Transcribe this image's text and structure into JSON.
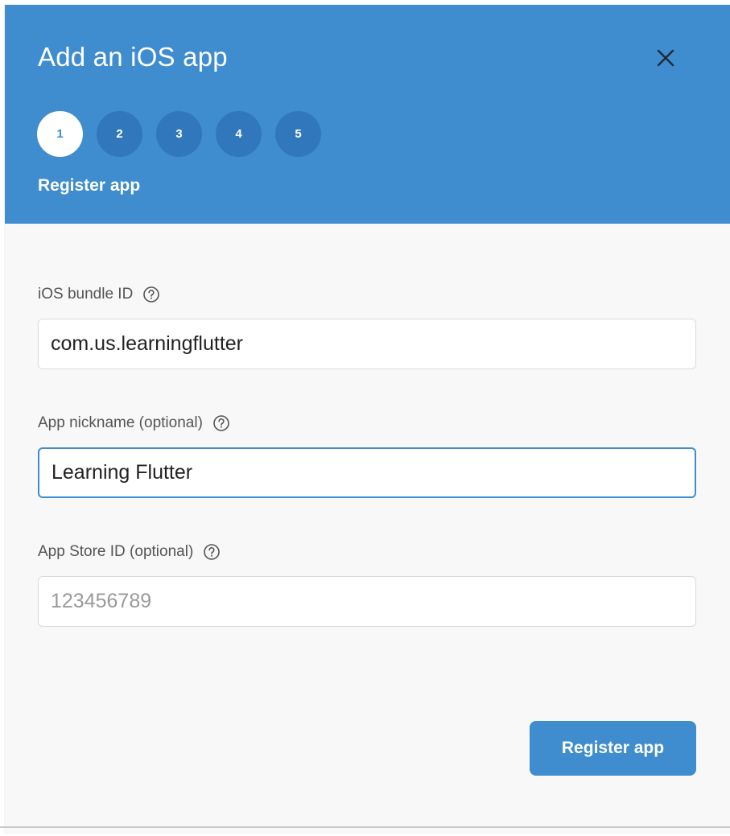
{
  "dialog": {
    "title": "Add an iOS app",
    "close_icon": "close-icon",
    "steps": [
      "1",
      "2",
      "3",
      "4",
      "5"
    ],
    "active_step": 1,
    "step_title": "Register app"
  },
  "form": {
    "bundle_id": {
      "label": "iOS bundle ID",
      "value": "com.us.learningflutter",
      "help_icon": "help-circle-icon"
    },
    "nickname": {
      "label": "App nickname (optional)",
      "value": "Learning Flutter",
      "help_icon": "help-circle-icon"
    },
    "app_store_id": {
      "label": "App Store ID (optional)",
      "value": "",
      "placeholder": "123456789",
      "help_icon": "help-circle-icon"
    }
  },
  "actions": {
    "register_label": "Register app"
  },
  "colors": {
    "header_bg": "#3f8dce",
    "step_inactive": "#3078bb",
    "button_bg": "#3f8dce",
    "panel_bg": "#f8f8f8"
  }
}
